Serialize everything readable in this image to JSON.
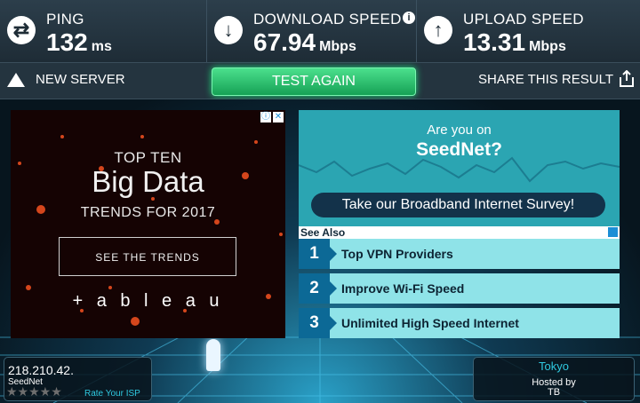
{
  "header": {
    "ping": {
      "label": "PING",
      "value": "132",
      "unit": "ms"
    },
    "download": {
      "label": "DOWNLOAD SPEED",
      "value": "67.94",
      "unit": "Mbps",
      "info_icon": "info-icon"
    },
    "upload": {
      "label": "UPLOAD SPEED",
      "value": "13.31",
      "unit": "Mbps"
    }
  },
  "actions": {
    "new_server": "NEW SERVER",
    "test_again": "TEST AGAIN",
    "share": "SHARE THIS RESULT"
  },
  "ad_left": {
    "line1": "TOP TEN",
    "line2": "Big Data",
    "line3": "TRENDS FOR 2017",
    "cta": "SEE THE TRENDS",
    "brand": "+ a b l e a u",
    "close_icons": [
      "ⓘ",
      "✕"
    ]
  },
  "ad_right": {
    "line1": "Are you on",
    "line2": "SeedNet?",
    "cta": "Take our Broadband Internet Survey!"
  },
  "see_also": {
    "title": "See Also",
    "items": [
      {
        "num": "1",
        "label": "Top VPN Providers"
      },
      {
        "num": "2",
        "label": "Improve Wi-Fi Speed"
      },
      {
        "num": "3",
        "label": "Unlimited High Speed Internet"
      }
    ]
  },
  "isp": {
    "ip": "218.210.42.",
    "name": "SeedNet",
    "stars": "★★★★★",
    "rate": "Rate Your ISP"
  },
  "server": {
    "city": "Tokyo",
    "hosted_by": "Hosted by",
    "host": "TB"
  },
  "colors": {
    "accent_green": "#1fdc7a",
    "accent_cyan": "#2fc9e0",
    "topbar": "#2c3e4b",
    "see_also_row": "#8fe3e8",
    "see_also_num": "#0c6996"
  }
}
